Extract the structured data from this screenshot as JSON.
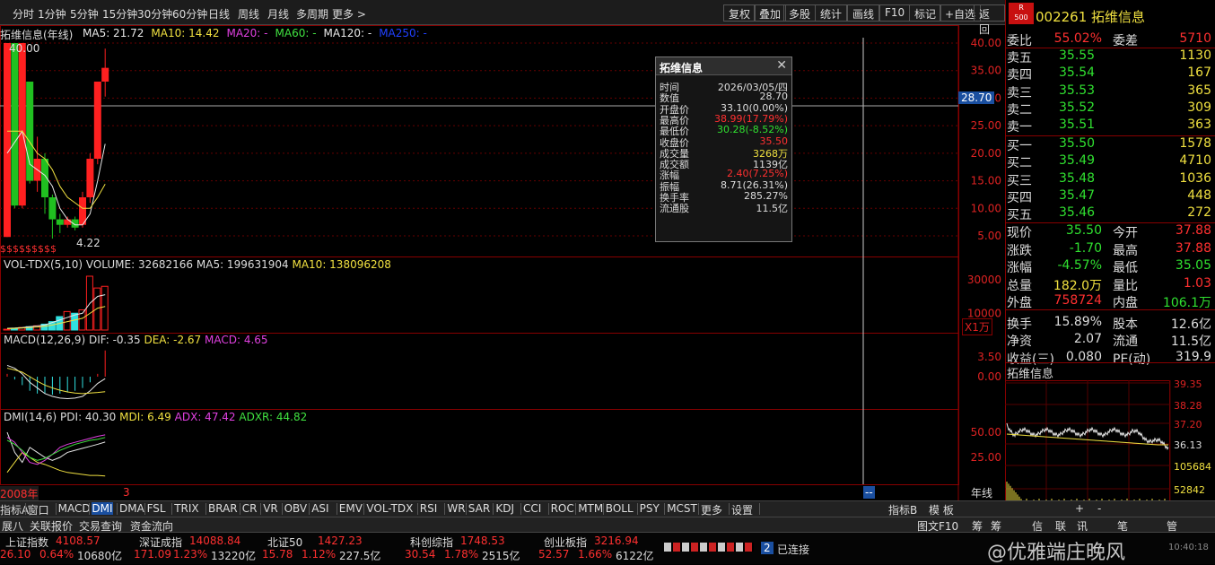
{
  "toolbar": {
    "left": [
      "分时",
      "1分钟",
      "5分钟",
      "15分钟",
      "30分钟",
      "60分钟",
      "日线",
      "周线",
      "月线",
      "多周期",
      "更多 >"
    ],
    "right": [
      "复权",
      "叠加",
      "多股",
      "统计",
      "画线",
      "F10",
      "标记",
      "+自选",
      "返回"
    ]
  },
  "main": {
    "title": "拓维信息(年线)",
    "ma": [
      {
        "label": "MA5: 21.72",
        "color": "#e8e8e8"
      },
      {
        "label": "MA10: 14.42",
        "color": "#f0e040"
      },
      {
        "label": "MA20: -",
        "color": "#e040e0"
      },
      {
        "label": "MA60: -",
        "color": "#40e040"
      },
      {
        "label": "MA120: -",
        "color": "#e8e8e8"
      },
      {
        "label": "MA250: -",
        "color": "#2040ff"
      }
    ],
    "high_label": "40.00",
    "low_label": "4.22",
    "crosshair_value": "28.70",
    "bottom_label": "$$$$$$$$$",
    "y_ticks": [
      "40.00",
      "35.00",
      "30.00",
      "25.00",
      "20.00",
      "15.00",
      "10.00",
      "5.00"
    ]
  },
  "popup": {
    "title": "拓维信息",
    "rows": [
      {
        "k": "时间",
        "v": "2026/03/05/四",
        "c": "#ddd"
      },
      {
        "k": "数值",
        "v": "28.70",
        "c": "#ddd"
      },
      {
        "k": "开盘价",
        "v": "33.10(0.00%)",
        "c": "#ddd"
      },
      {
        "k": "最高价",
        "v": "38.99(17.79%)",
        "c": "#ff3030"
      },
      {
        "k": "最低价",
        "v": "30.28(-8.52%)",
        "c": "#30e030"
      },
      {
        "k": "收盘价",
        "v": "35.50",
        "c": "#ff3030"
      },
      {
        "k": "成交量",
        "v": "3268万",
        "c": "#f0e040"
      },
      {
        "k": "成交额",
        "v": "1139亿",
        "c": "#ddd"
      },
      {
        "k": "涨幅",
        "v": "2.40(7.25%)",
        "c": "#ff3030"
      },
      {
        "k": "振幅",
        "v": "8.71(26.31%)",
        "c": "#ddd"
      },
      {
        "k": "换手率",
        "v": "285.27%",
        "c": "#ddd"
      },
      {
        "k": "流通股",
        "v": "11.5亿",
        "c": "#ddd"
      }
    ]
  },
  "vol": {
    "title": "VOL-TDX(5,10)",
    "volume": "VOLUME: 32682166",
    "ma5": "MA5: 199631904",
    "ma10": "MA10: 138096208",
    "ticks": [
      "30000",
      "10000"
    ],
    "unit": "X1万"
  },
  "macd": {
    "title": "MACD(12,26,9)",
    "dif": "DIF: -0.35",
    "dea": "DEA: -2.67",
    "macd": "MACD: 4.65",
    "ticks": [
      "3.50",
      "0.00"
    ]
  },
  "dmi": {
    "title": "DMI(14,6)",
    "pdi": "PDI: 40.30",
    "mdi": "MDI: 6.49",
    "adx": "ADX: 47.42",
    "adxr": "ADXR: 44.82",
    "ticks": [
      "50.00",
      "25.00"
    ],
    "x_start": "2008年",
    "x_mark": "3",
    "period": "年线"
  },
  "quote": {
    "code": "002261",
    "name": "拓维信息",
    "badge_top": "R",
    "badge_bottom": "500",
    "weibi_label": "委比",
    "weibi": "55.02%",
    "weicha_label": "委差",
    "weicha": "5710",
    "asks": [
      {
        "l": "卖五",
        "p": "35.55",
        "v": "1130"
      },
      {
        "l": "卖四",
        "p": "35.54",
        "v": "167"
      },
      {
        "l": "卖三",
        "p": "35.53",
        "v": "365"
      },
      {
        "l": "卖二",
        "p": "35.52",
        "v": "309"
      },
      {
        "l": "卖一",
        "p": "35.51",
        "v": "363"
      }
    ],
    "bids": [
      {
        "l": "买一",
        "p": "35.50",
        "v": "1578"
      },
      {
        "l": "买二",
        "p": "35.49",
        "v": "4710"
      },
      {
        "l": "买三",
        "p": "35.48",
        "v": "1036"
      },
      {
        "l": "买四",
        "p": "35.47",
        "v": "448"
      },
      {
        "l": "买五",
        "p": "35.46",
        "v": "272"
      }
    ],
    "stats": [
      {
        "l1": "现价",
        "v1": "35.50",
        "c1": "#30e030",
        "l2": "今开",
        "v2": "37.88",
        "c2": "#ff3030"
      },
      {
        "l1": "涨跌",
        "v1": "-1.70",
        "c1": "#30e030",
        "l2": "最高",
        "v2": "37.88",
        "c2": "#ff3030"
      },
      {
        "l1": "涨幅",
        "v1": "-4.57%",
        "c1": "#30e030",
        "l2": "最低",
        "v2": "35.05",
        "c2": "#30e030"
      },
      {
        "l1": "总量",
        "v1": "182.0万",
        "c1": "#f0e040",
        "l2": "量比",
        "v2": "1.03",
        "c2": "#ff3030"
      },
      {
        "l1": "外盘",
        "v1": "758724",
        "c1": "#ff3030",
        "l2": "内盘",
        "v2": "106.1万",
        "c2": "#30e030"
      },
      {
        "l1": "换手",
        "v1": "15.89%",
        "c1": "#ddd",
        "l2": "股本",
        "v2": "12.6亿",
        "c2": "#ddd"
      },
      {
        "l1": "净资",
        "v1": "2.07",
        "c1": "#ddd",
        "l2": "流通",
        "v2": "11.5亿",
        "c2": "#ddd"
      },
      {
        "l1": "收益(三)",
        "v1": "0.080",
        "c1": "#ddd",
        "l2": "PE(动)",
        "v2": "319.9",
        "c2": "#ddd"
      }
    ],
    "mini_title": "拓维信息",
    "mini_ticks": [
      "39.35",
      "38.28",
      "37.20",
      "36.13",
      "105684",
      "52842"
    ]
  },
  "tabs": [
    "指标A",
    "窗口",
    "MACD",
    "DMI",
    "DMA",
    "FSL",
    "TRIX",
    "BRAR",
    "CR",
    "VR",
    "OBV",
    "ASI",
    "EMV",
    "VOL-TDX",
    "RSI",
    "WR",
    "SAR",
    "KDJ",
    "CCI",
    "ROC",
    "MTM",
    "BOLL",
    "PSY",
    "MCST",
    "更多",
    "设置"
  ],
  "tabs_selected": "DMI",
  "tabs_right": [
    "指标B",
    "模 板"
  ],
  "tabs_right_extra": [
    "+",
    "-"
  ],
  "tabs2": [
    "展八",
    "关联报价",
    "交易查询",
    "资金流向"
  ],
  "tabs2_right": [
    "图文F10",
    "筹",
    "筹",
    "信",
    "联",
    "讯",
    "笔",
    "管"
  ],
  "status": [
    {
      "name": "上证指数",
      "idx": "4108.57",
      "chg": "26.10",
      "pct": "0.64%",
      "amt": "10680亿",
      "color": "#ff3030"
    },
    {
      "name": "深证成指",
      "idx": "14088.84",
      "chg": "171.09",
      "pct": "1.23%",
      "amt": "13220亿",
      "color": "#ff3030"
    },
    {
      "name": "北证50",
      "idx": "1427.23",
      "chg": "15.78",
      "pct": "1.12%",
      "amt": "227.5亿",
      "color": "#ff3030"
    },
    {
      "name": "科创综指",
      "idx": "1748.53",
      "chg": "30.54",
      "pct": "1.78%",
      "amt": "2515亿",
      "color": "#ff3030"
    },
    {
      "name": "创业板指",
      "idx": "3216.94",
      "chg": "52.57",
      "pct": "1.66%",
      "amt": "6122亿",
      "color": "#ff3030"
    }
  ],
  "connected": "已连接",
  "conn_num": "2",
  "clock": "10:40:18",
  "watermark": "@优雅端庄晚风",
  "candles": [
    {
      "o": 4.8,
      "c": 40,
      "h": 40,
      "l": 4.8
    },
    {
      "o": 40,
      "c": 10.5,
      "h": 40,
      "l": 10
    },
    {
      "o": 10.5,
      "c": 40,
      "h": 40,
      "l": 10
    },
    {
      "o": 33,
      "c": 15,
      "h": 33,
      "l": 14.5
    },
    {
      "o": 15,
      "c": 19,
      "h": 23,
      "l": 13
    },
    {
      "o": 19,
      "c": 12,
      "h": 20,
      "l": 9
    },
    {
      "o": 12,
      "c": 8,
      "h": 12.5,
      "l": 4.5
    },
    {
      "o": 8,
      "c": 7,
      "h": 9,
      "l": 5.5
    },
    {
      "o": 7,
      "c": 8,
      "h": 8.5,
      "l": 6.5
    },
    {
      "o": 8,
      "c": 6.5,
      "h": 8.5,
      "l": 6
    },
    {
      "o": 7,
      "c": 12,
      "h": 13,
      "l": 6.5
    },
    {
      "o": 12,
      "c": 19,
      "h": 20,
      "l": 11
    },
    {
      "o": 19,
      "c": 33,
      "h": 33,
      "l": 18
    },
    {
      "o": 33,
      "c": 35.5,
      "h": 38.99,
      "l": 30.28
    }
  ],
  "ma5_line": [
    20,
    22,
    24,
    18,
    17,
    16,
    14,
    10,
    8,
    7,
    7,
    9,
    15,
    21.7
  ],
  "ma10_line": [
    24,
    24,
    24,
    22,
    20,
    19,
    17,
    14,
    12,
    11,
    10,
    10,
    12,
    14.4
  ],
  "volumes": [
    500,
    900,
    1500,
    2000,
    2500,
    3500,
    5000,
    8000,
    11000,
    10000,
    12000,
    32000,
    25000,
    26000
  ],
  "vol_ma5": [
    1000,
    1200,
    1500,
    2000,
    2500,
    3000,
    4500,
    6000,
    7500,
    9000,
    10000,
    16000,
    20000,
    21000
  ],
  "vol_ma10": [
    800,
    1000,
    1200,
    1500,
    1800,
    2200,
    3000,
    4000,
    5000,
    6000,
    7000,
    10000,
    13000,
    14000
  ],
  "macd_bars": [
    0.5,
    -0.5,
    -1.5,
    -2.5,
    -3,
    -3,
    -3.2,
    -3,
    -2.8,
    -2.5,
    -2,
    -1,
    0.5,
    4.65
  ],
  "macd_dif": [
    2,
    1.5,
    0.5,
    -1,
    -2,
    -3,
    -3.5,
    -3.8,
    -3.9,
    -3.8,
    -3.5,
    -2.5,
    -1.2,
    -0.35
  ],
  "macd_dea": [
    1.5,
    1.2,
    0.8,
    0,
    -0.8,
    -1.5,
    -2,
    -2.4,
    -2.7,
    -2.9,
    -3,
    -2.9,
    -2.8,
    -2.67
  ],
  "dmi_pdi": [
    50,
    30,
    20,
    35,
    30,
    25,
    22,
    25,
    30,
    32,
    34,
    36,
    38,
    40.3
  ],
  "dmi_mdi": [
    10,
    20,
    30,
    25,
    20,
    18,
    15,
    12,
    10,
    9,
    8,
    7,
    7,
    6.49
  ],
  "dmi_adx": [
    45,
    40,
    30,
    20,
    18,
    22,
    28,
    35,
    38,
    40,
    42,
    44,
    46,
    47.42
  ],
  "dmi_adxr": [
    42,
    38,
    32,
    25,
    22,
    24,
    28,
    32,
    35,
    38,
    40,
    42,
    43,
    44.82
  ]
}
